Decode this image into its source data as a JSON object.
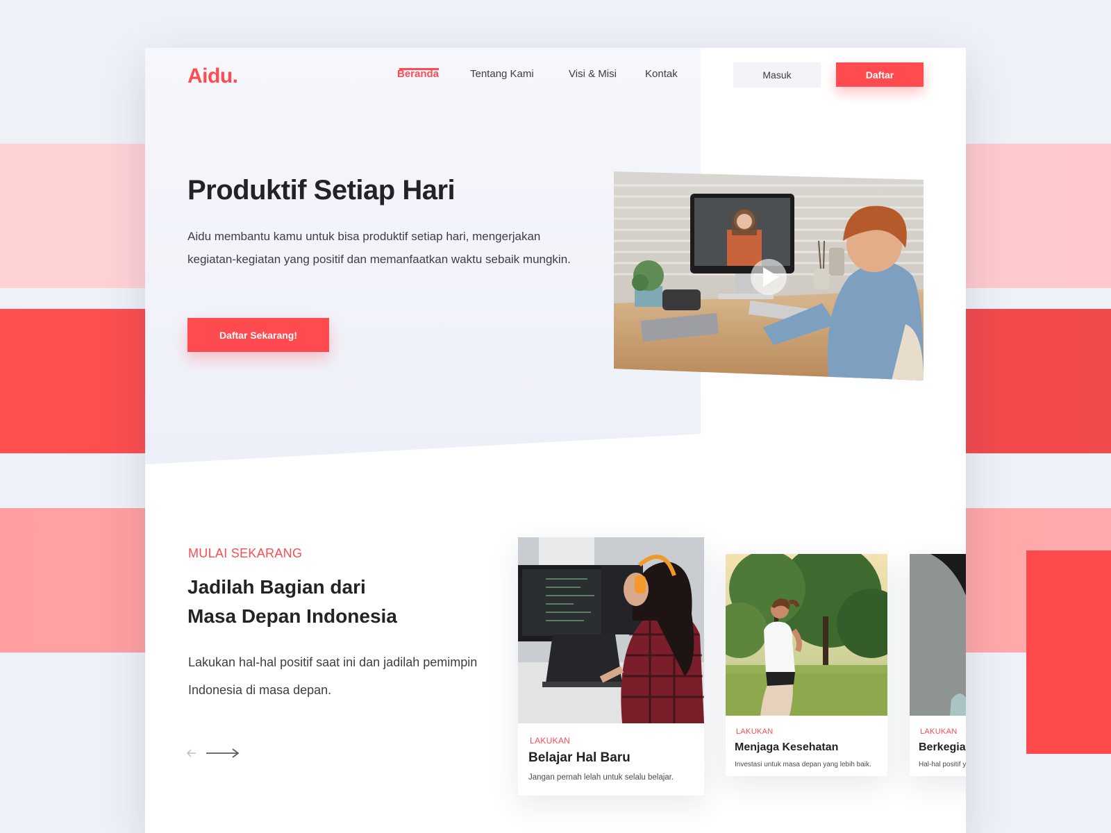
{
  "brand": {
    "logo": "Aidu.",
    "accent": "#ff4b4f"
  },
  "nav": {
    "items": [
      {
        "label": "Beranda",
        "active": true
      },
      {
        "label": "Tentang Kami",
        "active": false
      },
      {
        "label": "Visi & Misi",
        "active": false
      },
      {
        "label": "Kontak",
        "active": false
      }
    ]
  },
  "auth": {
    "login_label": "Masuk",
    "register_label": "Daftar"
  },
  "hero": {
    "title": "Produktif Setiap Hari",
    "description": "Aidu membantu kamu untuk bisa produktif setiap hari, mengerjakan kegiatan-kegiatan yang positif dan memanfaatkan waktu sebaik mungkin.",
    "cta_label": "Daftar Sekarang!",
    "video_icon": "play-icon"
  },
  "section": {
    "eyebrow": "MULAI SEKARANG",
    "title_line1": "Jadilah Bagian dari",
    "title_line2": "Masa Depan Indonesia",
    "description": "Lakukan hal-hal positif saat ini dan jadilah pemimpin Indonesia di masa depan.",
    "prev_icon": "arrow-left-icon",
    "next_icon": "arrow-right-icon"
  },
  "cards": [
    {
      "tag": "LAKUKAN",
      "title": "Belajar Hal Baru",
      "desc": "Jangan pernah lelah untuk selalu belajar."
    },
    {
      "tag": "LAKUKAN",
      "title": "Menjaga Kesehatan",
      "desc": "Investasi untuk masa depan yang lebih baik."
    },
    {
      "tag": "LAKUKAN",
      "title": "Berkegia",
      "desc": "Hal-hal positif y"
    }
  ]
}
